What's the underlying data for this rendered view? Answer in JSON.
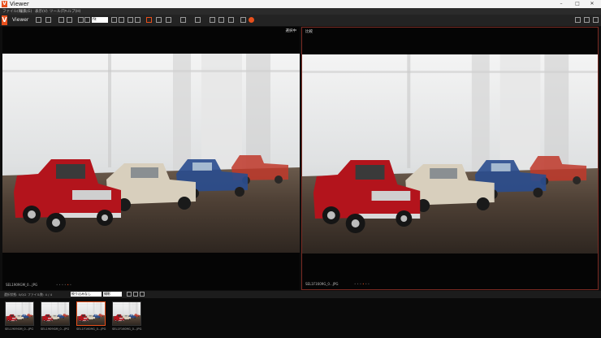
{
  "window": {
    "title": "Viewer",
    "logo": "V"
  },
  "menu": [
    "ファイル(F)",
    "編集(E)",
    "表示(V)",
    "ツール(T)",
    "ヘルプ(H)"
  ],
  "appbar": {
    "logo": "V",
    "title": "Viewer",
    "zoom_value": "fit"
  },
  "panels": {
    "left": {
      "label": "選択中",
      "filename": "SEL1909GM_0...JPG"
    },
    "right": {
      "label": "比較",
      "filename": "SEL1F1609G_0...JPG"
    }
  },
  "filterbar": {
    "count_label": "選択状態: 0/0/2",
    "file_label": "ファイル数: 4 / 4",
    "filter_value": "絞り込みなし",
    "sort_value": "撮影"
  },
  "thumbnails": [
    {
      "label": "SEL1909GM_0...JPG"
    },
    {
      "label": "SEL1909GM_0...JPG"
    },
    {
      "label": "SEL1F1609G_0...JPG"
    },
    {
      "label": "SEL1F1609G_0...JPG"
    }
  ],
  "colors": {
    "accent": "#e8501c",
    "background": "#0e0e0e",
    "selected_border": "#7a2a22"
  },
  "icons": [
    "minimize-icon",
    "maximize-icon",
    "close-icon",
    "settings-icon",
    "view-grid-icon",
    "view-single-icon",
    "view-compare-icon"
  ]
}
